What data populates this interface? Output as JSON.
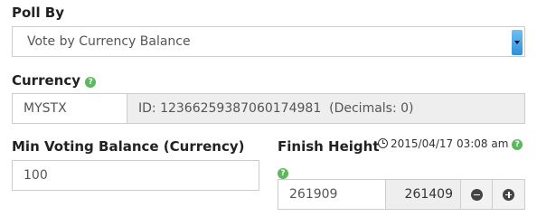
{
  "poll_by": {
    "label": "Poll By",
    "selected": "Vote by Currency Balance"
  },
  "currency": {
    "label": "Currency",
    "value": "MYSTX",
    "info": "ID: 12366259387060174981  (Decimals: 0)"
  },
  "min_voting_balance": {
    "label": "Min Voting Balance (Currency)",
    "value": "100"
  },
  "finish_height": {
    "label": "Finish Height",
    "date": "2015/04/17 03:08 am",
    "value": "261909",
    "current": "261409"
  }
}
